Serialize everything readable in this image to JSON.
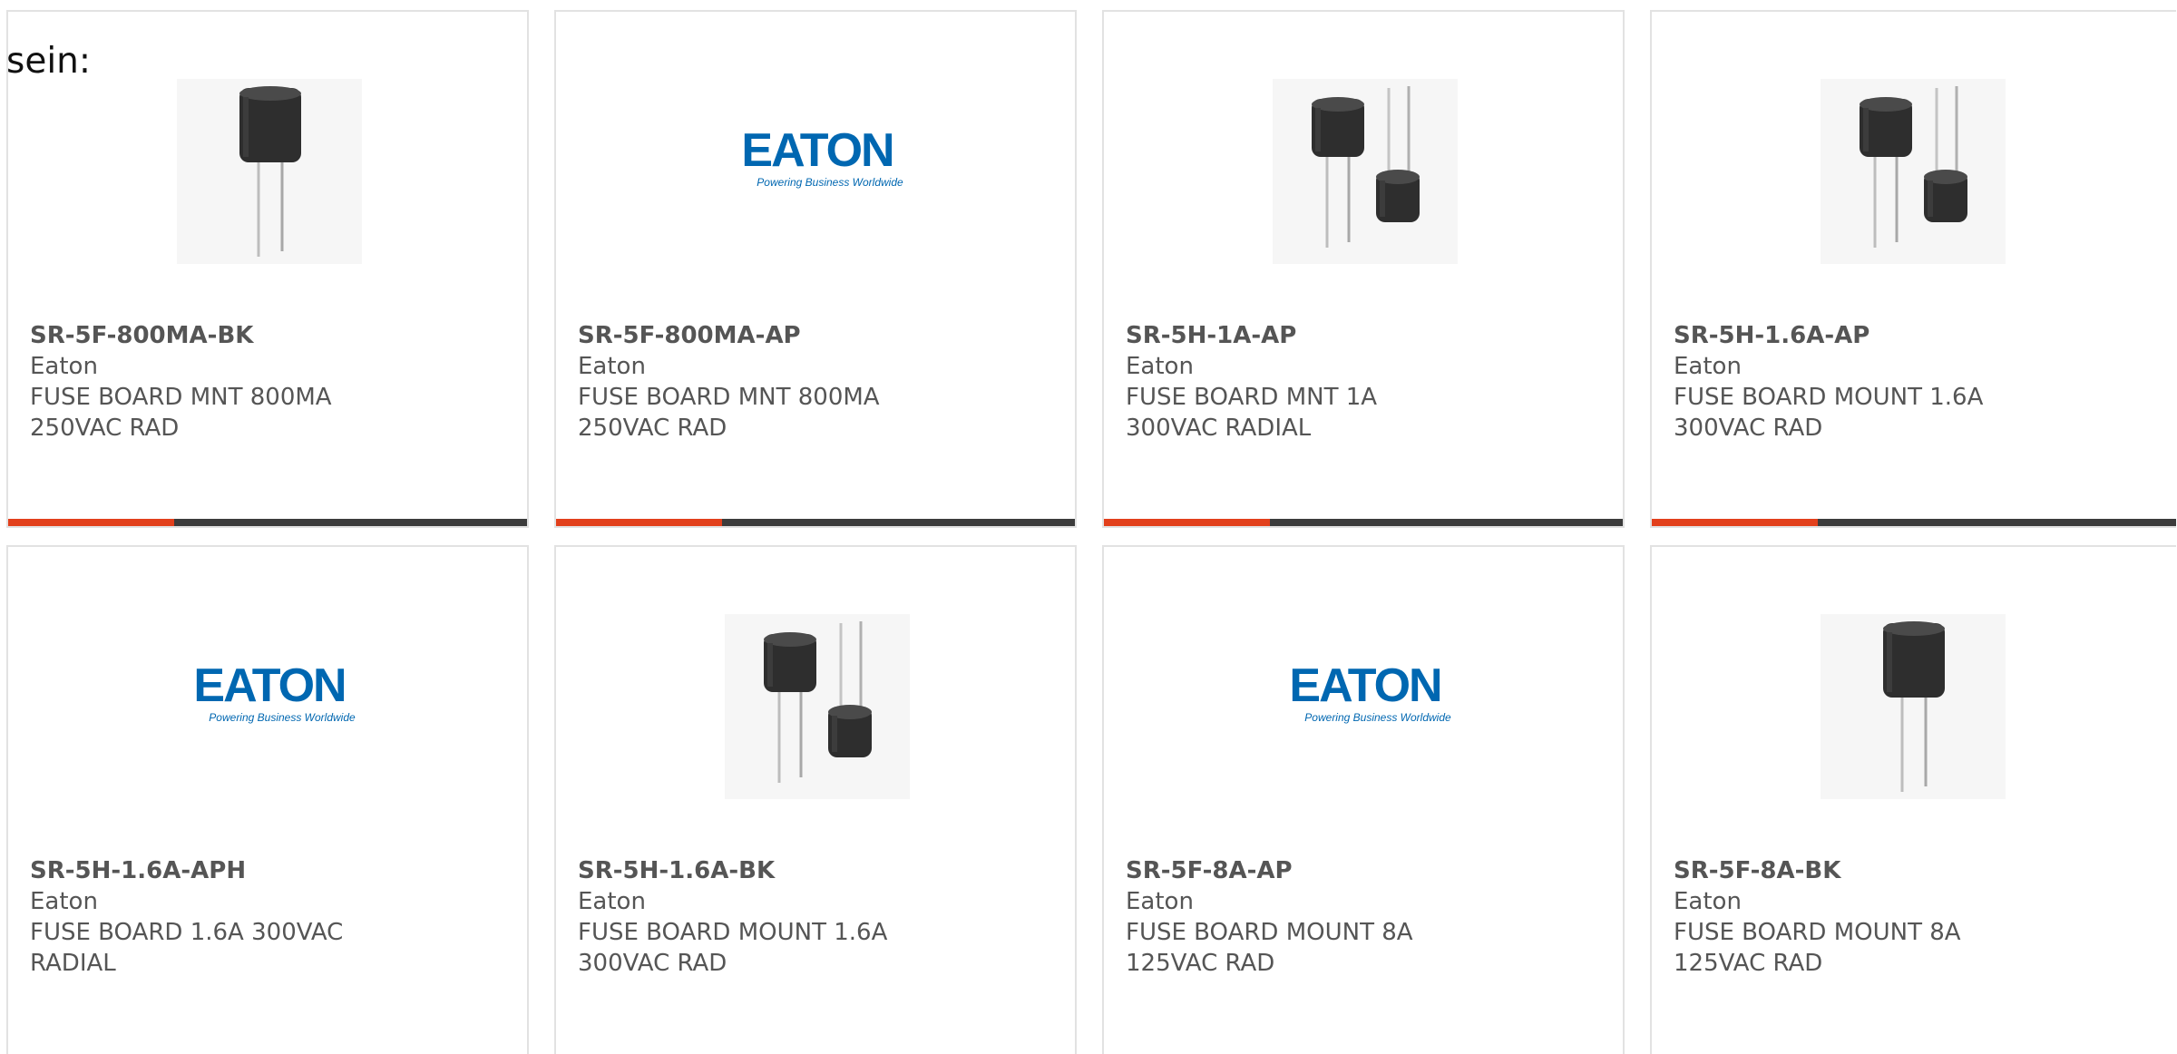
{
  "intro_text": "sein:",
  "colors": {
    "accent": "#e2401c",
    "bar": "#3c3c3c",
    "eaton_blue": "#0067b1"
  },
  "logo": {
    "wordmark": "EATON",
    "tagline": "Powering Business Worldwide"
  },
  "products": [
    {
      "part_number": "SR-5F-800MA-BK",
      "manufacturer": "Eaton",
      "description": "FUSE BOARD MNT 800MA 250VAC RAD",
      "image": "single-fuse"
    },
    {
      "part_number": "SR-5F-800MA-AP",
      "manufacturer": "Eaton",
      "description": "FUSE BOARD MNT 800MA 250VAC RAD",
      "image": "eaton-logo"
    },
    {
      "part_number": "SR-5H-1A-AP",
      "manufacturer": "Eaton",
      "description": "FUSE BOARD MNT 1A 300VAC RADIAL",
      "image": "double-fuse"
    },
    {
      "part_number": "SR-5H-1.6A-AP",
      "manufacturer": "Eaton",
      "description": "FUSE BOARD MOUNT 1.6A 300VAC RAD",
      "image": "double-fuse"
    },
    {
      "part_number": "SR-5H-1.6A-APH",
      "manufacturer": "Eaton",
      "description": "FUSE BOARD 1.6A 300VAC RADIAL",
      "image": "eaton-logo"
    },
    {
      "part_number": "SR-5H-1.6A-BK",
      "manufacturer": "Eaton",
      "description": "FUSE BOARD MOUNT 1.6A 300VAC RAD",
      "image": "double-fuse"
    },
    {
      "part_number": "SR-5F-8A-AP",
      "manufacturer": "Eaton",
      "description": "FUSE BOARD MOUNT 8A 125VAC RAD",
      "image": "eaton-logo"
    },
    {
      "part_number": "SR-5F-8A-BK",
      "manufacturer": "Eaton",
      "description": "FUSE BOARD MOUNT 8A 125VAC RAD",
      "image": "single-fuse"
    }
  ]
}
